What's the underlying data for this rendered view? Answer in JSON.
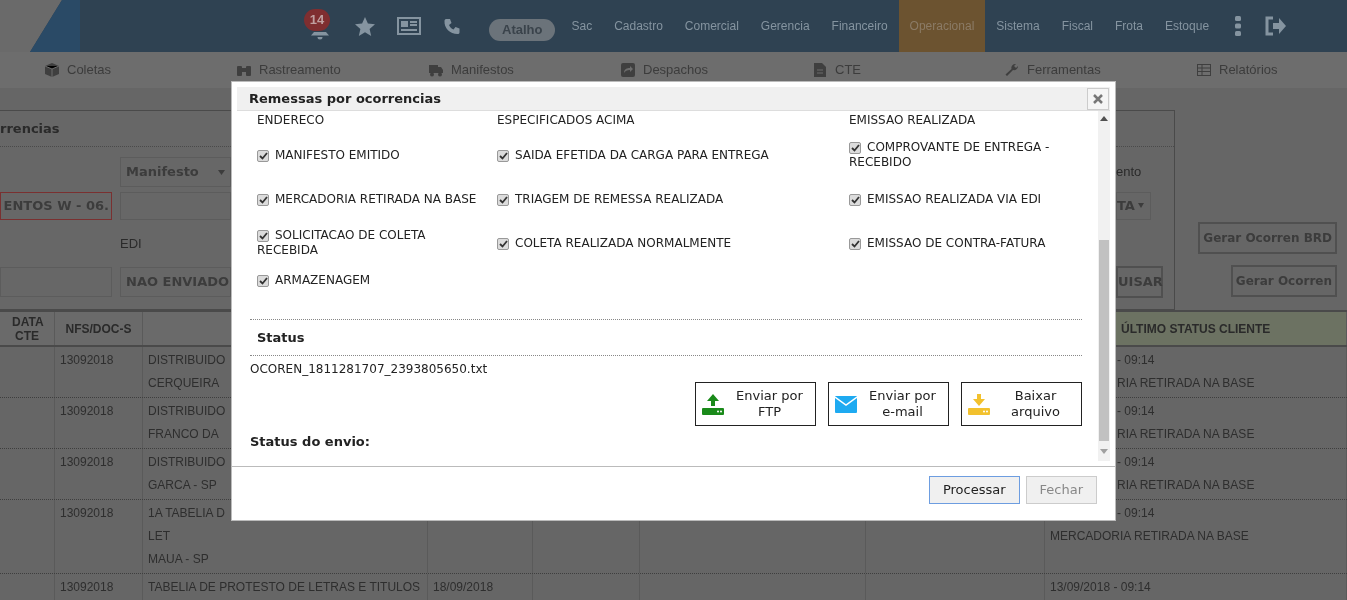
{
  "top_nav": {
    "notification_count": "14",
    "shortcut": "Atalho",
    "menu": [
      {
        "label": "Sac",
        "selected": false
      },
      {
        "label": "Cadastro",
        "selected": false
      },
      {
        "label": "Comercial",
        "selected": false
      },
      {
        "label": "Gerencia",
        "selected": false
      },
      {
        "label": "Financeiro",
        "selected": false
      },
      {
        "label": "Operacional",
        "selected": true
      },
      {
        "label": "Sistema",
        "selected": false
      },
      {
        "label": "Fiscal",
        "selected": false
      },
      {
        "label": "Frota",
        "selected": false
      },
      {
        "label": "Estoque",
        "selected": false
      }
    ]
  },
  "sub_nav": [
    "Coletas",
    "Rastreamento",
    "Manifestos",
    "Despachos",
    "CTE",
    "Ferramentas",
    "Relatórios"
  ],
  "filter_panel": {
    "title_tail": "rrencias",
    "document_type": "Manifesto",
    "client_field": {
      "value": "ENTOS W - 06.",
      "invalid": true
    },
    "edi_label": "EDI",
    "edi_status": "NAO ENVIADO",
    "right_label_tail": "ento",
    "right_select_tail": "TA",
    "search_button_tail": "UISAR",
    "buttons": [
      "Gerar Ocorren BRD",
      "Gerar Ocorren"
    ]
  },
  "table": {
    "header": {
      "column_1": "DATA CTE",
      "column_2": "NFS/DOC-S",
      "column_8": "ÚLTIMO STATUS CLIENTE"
    },
    "rows": [
      {
        "column_2": [
          "13092018"
        ],
        "column_3": [
          "DISTRIBUIDO",
          "CERQUEIRA"
        ],
        "column_8": [
          "- 09:14",
          "RIA RETIRADA NA BASE"
        ]
      },
      {
        "column_2": [
          "13092018"
        ],
        "column_3": [
          "DISTRIBUIDO",
          "FRANCO DA"
        ],
        "column_8": [
          "- 09:14",
          "RIA RETIRADA NA BASE"
        ]
      },
      {
        "column_2": [
          "13092018"
        ],
        "column_3": [
          "DISTRIBUIDO",
          "GARCA - SP"
        ],
        "column_8": [
          "- 09:14",
          "RIA RETIRADA NA BASE"
        ]
      },
      {
        "column_2": [
          "13092018"
        ],
        "column_3": [
          "1A TABELIA D",
          "LET",
          "MAUA - SP"
        ],
        "column_8": [
          "- 09:14",
          "MERCADORIA RETIRADA NA BASE"
        ]
      },
      {
        "column_2": [
          "13092018"
        ],
        "column_3": [
          "TABELIA DE PROTESTO DE LETRAS E TITULOS"
        ],
        "column_4": [
          "18/09/2018"
        ],
        "column_8": [
          "13/09/2018 - 09:14"
        ]
      }
    ]
  },
  "dialog": {
    "title": "Remessas por ocorrencias",
    "wrapped_tails": [
      "ENDERECO",
      "ESPECIFICADOS ACIMA",
      "EMISSAO REALIZADA"
    ],
    "rows": [
      [
        {
          "label": "MANIFESTO EMITIDO",
          "checked": true
        },
        {
          "label": "SAIDA EFETIDA DA CARGA PARA ENTREGA",
          "checked": true
        },
        {
          "label": "COMPROVANTE DE ENTREGA - RECEBIDO",
          "checked": true
        }
      ],
      [
        {
          "label": "MERCADORIA RETIRADA NA BASE",
          "checked": true
        },
        {
          "label": "TRIAGEM DE REMESSA REALIZADA",
          "checked": true
        },
        {
          "label": "EMISSAO REALIZADA VIA EDI",
          "checked": true
        }
      ],
      [
        {
          "label": "SOLICITACAO DE COLETA RECEBIDA",
          "checked": true
        },
        {
          "label": "COLETA REALIZADA NORMALMENTE",
          "checked": true
        },
        {
          "label": "EMISSAO DE CONTRA-FATURA",
          "checked": true
        }
      ],
      [
        {
          "label": "ARMAZENAGEM",
          "checked": true
        }
      ]
    ],
    "status_heading": "Status",
    "file_name": "OCOREN_1811281707_2393805650.txt",
    "send_buttons": [
      "Enviar por FTP",
      "Enviar por e-mail",
      "Baixar arquivo"
    ],
    "send_status_label": "Status do envio:",
    "footer_buttons": [
      {
        "label": "Processar",
        "disabled": false,
        "focused": true
      },
      {
        "label": "Fechar",
        "disabled": true,
        "focused": false
      }
    ]
  }
}
